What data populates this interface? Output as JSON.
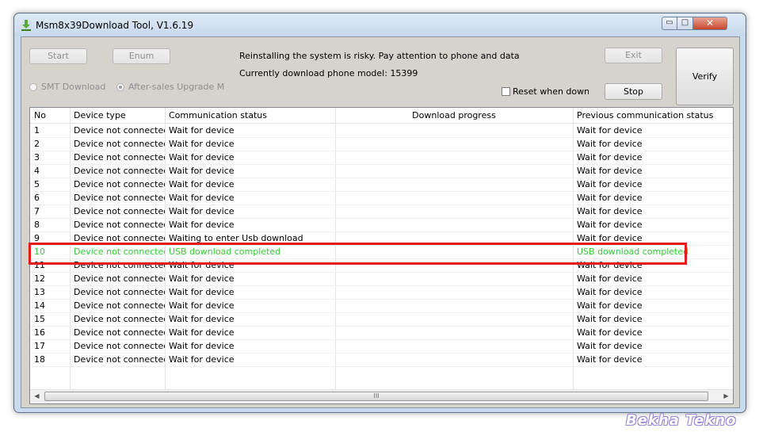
{
  "window": {
    "title": "Msm8x39Download Tool, V1.6.19",
    "controls": {
      "minimize": "▭",
      "maximize": "□",
      "close": "✕"
    }
  },
  "toolbar": {
    "start_label": "Start",
    "enum_label": "Enum",
    "exit_label": "Exit",
    "stop_label": "Stop",
    "verify_label": "Verify",
    "warning_text": "Reinstalling the system is risky. Pay attention to phone and data",
    "model_text": "Currently download phone model: 15399",
    "radio_smt_label": "SMT Download Mc",
    "radio_aftersales_label": "After-sales Upgrade Moc",
    "reset_checkbox_label": "Reset when downlc"
  },
  "table": {
    "headers": [
      "No",
      "Device type",
      "Communication status",
      "Download progress",
      "Previous communication status"
    ],
    "rows": [
      [
        "1",
        "Device not connected",
        "Wait for device",
        "",
        "Wait for device"
      ],
      [
        "2",
        "Device not connected",
        "Wait for device",
        "",
        "Wait for device"
      ],
      [
        "3",
        "Device not connected",
        "Wait for device",
        "",
        "Wait for device"
      ],
      [
        "4",
        "Device not connected",
        "Wait for device",
        "",
        "Wait for device"
      ],
      [
        "5",
        "Device not connected",
        "Wait for device",
        "",
        "Wait for device"
      ],
      [
        "6",
        "Device not connected",
        "Wait for device",
        "",
        "Wait for device"
      ],
      [
        "7",
        "Device not connected",
        "Wait for device",
        "",
        "Wait for device"
      ],
      [
        "8",
        "Device not connected",
        "Wait for device",
        "",
        "Wait for device"
      ],
      [
        "9",
        "Device not connected",
        "Waiting to enter Usb download",
        "",
        "Wait for device"
      ],
      [
        "10",
        "Device not connected",
        "USB download completed",
        "",
        "USB download completed"
      ],
      [
        "11",
        "Device not connected",
        "Wait for device",
        "",
        "Wait for device"
      ],
      [
        "12",
        "Device not connected",
        "Wait for device",
        "",
        "Wait for device"
      ],
      [
        "13",
        "Device not connected",
        "Wait for device",
        "",
        "Wait for device"
      ],
      [
        "14",
        "Device not connected",
        "Wait for device",
        "",
        "Wait for device"
      ],
      [
        "15",
        "Device not connected",
        "Wait for device",
        "",
        "Wait for device"
      ],
      [
        "16",
        "Device not connected",
        "Wait for device",
        "",
        "Wait for device"
      ],
      [
        "17",
        "Device not connected",
        "Wait for device",
        "",
        "Wait for device"
      ],
      [
        "18",
        "Device not connected",
        "Wait for device",
        "",
        "Wait for device"
      ]
    ],
    "highlight_row_index": 9,
    "scroll_left_icon": "◀",
    "scroll_right_icon": "▶",
    "scroll_grip": "III"
  },
  "colors": {
    "completed_text": "#33cc33",
    "highlight_border": "#e21b1b"
  },
  "watermark": "Bekha Tekno"
}
